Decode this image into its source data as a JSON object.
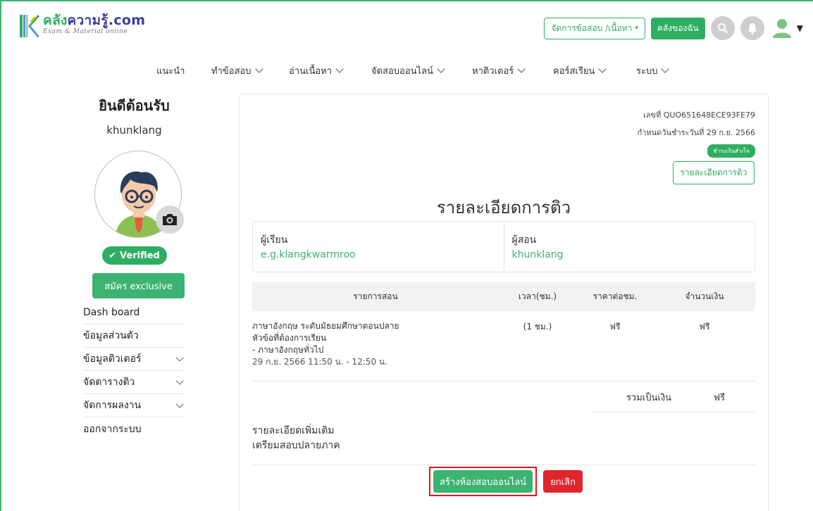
{
  "colors": {
    "brand_green": "#2eae61",
    "brand_blue": "#3a3f9b",
    "cancel_red": "#e0262c",
    "highlight_red": "#e0171f"
  },
  "header": {
    "logo_main": "คลัง",
    "logo_rest": "ความรู้.com",
    "logo_sub": "Exam & Material online",
    "manage_btn": "จัดการข้อสอบ /เนื้อหา",
    "mine_btn": "คลังของฉัน",
    "icons": [
      "search-icon",
      "bell-icon",
      "user-icon",
      "caret-down-icon"
    ]
  },
  "nav": {
    "items": [
      {
        "label": "แนะนำ",
        "dropdown": false
      },
      {
        "label": "ทำข้อสอบ",
        "dropdown": true
      },
      {
        "label": "อ่านเนื้อหา",
        "dropdown": true
      },
      {
        "label": "จัดสอบออนไลน์",
        "dropdown": true
      },
      {
        "label": "หาติวเตอร์",
        "dropdown": true
      },
      {
        "label": "คอร์สเรียน",
        "dropdown": true
      },
      {
        "label": "ระบบ",
        "dropdown": true
      }
    ]
  },
  "sidebar": {
    "welcome": "ยินดีต้อนรับ",
    "username": "khunklang",
    "verified": "Verified",
    "exclusive_btn": "สมัคร exclusive",
    "menu": [
      {
        "label": "Dash board",
        "dropdown": false
      },
      {
        "label": "ข้อมูลส่วนตัว",
        "dropdown": false
      },
      {
        "label": "ข้อมูลติวเตอร์",
        "dropdown": true
      },
      {
        "label": "จัดตารางติว",
        "dropdown": true
      },
      {
        "label": "จัดการผลงาน",
        "dropdown": true
      },
      {
        "label": "ออกจากระบบ",
        "dropdown": false
      }
    ]
  },
  "main": {
    "doc_no": "เลขที่ QUO651648ECE93FE79",
    "due": "กำหนดวันชำระวันที่ 29 ก.ย. 2566",
    "status": "ชำระเงินสำเร็จ",
    "detail_btn": "รายละเอียดการติว",
    "title": "รายละเอียดการติว",
    "student_label": "ผู้เรียน",
    "student_value": "e.g.klangkwarmroo",
    "tutor_label": "ผู้สอน",
    "tutor_value": "khunklang",
    "table": {
      "headers": [
        "รายการสอน",
        "เวลา(ชม.)",
        "ราคาต่อชม.",
        "จำนวนเงิน"
      ],
      "row": {
        "line1": "ภาษาอังกฤษ ระดับมัธยมศึกษาตอนปลาย",
        "line2": "หัวข้อที่ต้องการเรียน",
        "line3": "- ภาษาอังกฤษทั่วไป",
        "line4": "29 ก.ย. 2566 11:50 น. - 12:50 น.",
        "hours": "(1 ชม.)",
        "price": "ฟรี",
        "amount": "ฟรี"
      },
      "total_label": "รวมเป็นเงิน",
      "total_value": "ฟรี"
    },
    "extra_label": "รายละเอียดเพิ่มเติม",
    "extra_value": "เตรียมสอบปลายภาค",
    "create_btn": "สร้างห้องสอบออนไลน์",
    "cancel_btn": "ยกเลิก"
  }
}
